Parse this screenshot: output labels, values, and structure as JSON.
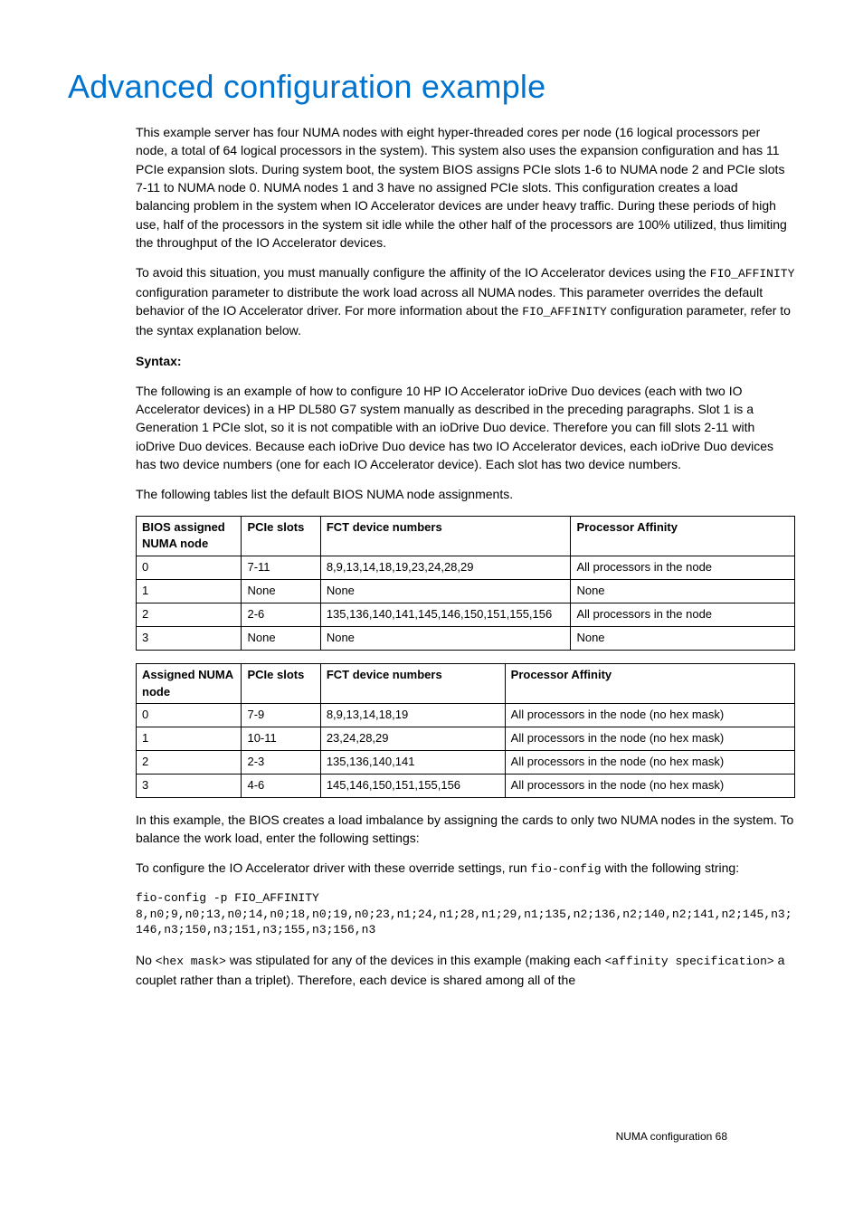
{
  "title": "Advanced configuration example",
  "p1": "This example server has four NUMA nodes with eight hyper-threaded cores per node (16 logical processors per node, a total of 64 logical processors in the system). This system also uses the expansion configuration and has 11 PCIe expansion slots. During system boot, the system BIOS assigns PCIe slots 1-6 to NUMA node 2 and PCIe slots 7-11 to NUMA node 0. NUMA nodes 1 and 3 have no assigned PCIe slots. This configuration creates a load balancing problem in the system when IO Accelerator devices are under heavy traffic. During these periods of high use, half of the processors in the system sit idle while the other half of the processors are 100% utilized, thus limiting the throughput of the IO Accelerator devices.",
  "p2a": "To avoid this situation, you must manually configure the affinity of the IO Accelerator devices using the ",
  "p2_code1": "FIO_AFFINITY",
  "p2b": " configuration parameter to distribute the work load across all NUMA nodes. This parameter overrides the default behavior of the IO Accelerator driver. For more information about the ",
  "p2_code2": "FIO_AFFINITY",
  "p2c": " configuration parameter, refer to the syntax explanation below.",
  "syntax_label": "Syntax:",
  "p3": "The following is an example of how to configure 10 HP IO Accelerator ioDrive Duo devices (each with two IO Accelerator devices) in a HP DL580 G7 system manually as described in the preceding paragraphs. Slot 1 is a Generation 1 PCIe slot, so it is not compatible with an ioDrive Duo device. Therefore you can fill slots 2-11 with ioDrive Duo devices. Because each ioDrive Duo device has two IO Accelerator devices, each ioDrive Duo devices has two device numbers (one for each IO Accelerator device). Each slot has two device numbers.",
  "p4": "The following tables list the default BIOS NUMA node assignments.",
  "table1": {
    "headers": [
      "BIOS assigned NUMA node",
      "PCIe slots",
      "FCT device numbers",
      "Processor Affinity"
    ],
    "rows": [
      [
        "0",
        "7-11",
        "8,9,13,14,18,19,23,24,28,29",
        "All processors in the node"
      ],
      [
        "1",
        "None",
        "None",
        "None"
      ],
      [
        "2",
        "2-6",
        "135,136,140,141,145,146,150,151,155,156",
        "All processors in the node"
      ],
      [
        "3",
        "None",
        "None",
        "None"
      ]
    ]
  },
  "table2": {
    "headers": [
      "Assigned NUMA node",
      "PCIe slots",
      "FCT device numbers",
      "Processor Affinity"
    ],
    "rows": [
      [
        "0",
        "7-9",
        "8,9,13,14,18,19",
        "All processors in the node (no hex mask)"
      ],
      [
        "1",
        "10-11",
        "23,24,28,29",
        "All processors in the node (no hex mask)"
      ],
      [
        "2",
        "2-3",
        "135,136,140,141",
        "All processors in the node (no hex mask)"
      ],
      [
        "3",
        "4-6",
        "145,146,150,151,155,156",
        "All processors in the node (no hex mask)"
      ]
    ]
  },
  "p5": "In this example, the BIOS creates a load imbalance by assigning the cards to only two NUMA nodes in the system. To balance the work load, enter the following settings:",
  "p6a": "To configure the IO Accelerator driver with these override settings, run ",
  "p6_code": "fio-config",
  "p6b": " with the following string:",
  "codeblock": "fio-config -p FIO_AFFINITY\n8,n0;9,n0;13,n0;14,n0;18,n0;19,n0;23,n1;24,n1;28,n1;29,n1;135,n2;136,n2;140,n2;141,n2;145,n3;146,n3;150,n3;151,n3;155,n3;156,n3",
  "p7a": "No ",
  "p7_code1": "<hex mask>",
  "p7b": " was stipulated for any of the devices in this example (making each ",
  "p7_code2": "<affinity specification>",
  "p7c": " a couplet rather than a triplet). Therefore, each device is shared among all of the",
  "footer": "NUMA configuration   68"
}
